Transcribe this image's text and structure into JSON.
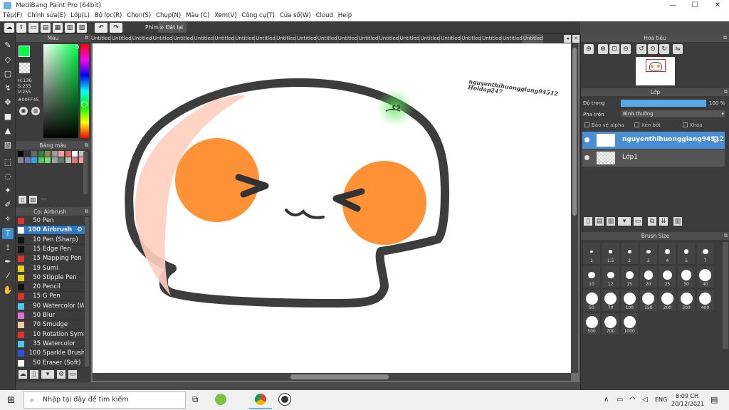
{
  "window": {
    "title": "MediBang Paint Pro (64bit)",
    "min": "—",
    "max": "☐",
    "close": "✕"
  },
  "menu": [
    "Tệp(F)",
    "Chỉnh sửa(E)",
    "Lớp(L)",
    "Bộ lọc(R)",
    "Chọn(S)",
    "Chụp(N)",
    "Màu (C)",
    "Xem(V)",
    "Công cụ(T)",
    "Cửa sổ(W)",
    "Cloud",
    "Help"
  ],
  "toolbar": {
    "phim_label": "Phím",
    "reset_label": "Đặt lại"
  },
  "tabs": {
    "label": "Untitled"
  },
  "color_panel": {
    "title": "Màu",
    "h": "H:136",
    "s": "S:255",
    "v": "V:255",
    "hex": "#00FF45",
    "fg_color": "#00ff45"
  },
  "swatch_panel": {
    "title": "Bảng màu",
    "value": "---"
  },
  "brush_panel": {
    "title": "Cọ: Airbrush",
    "brushes": [
      {
        "size": "50",
        "name": "Pen",
        "color": "#e03030"
      },
      {
        "size": "100",
        "name": "Airbrush",
        "color": "#ffffff"
      },
      {
        "size": "10",
        "name": "Pen (Sharp)",
        "color": "#111111"
      },
      {
        "size": "15",
        "name": "Edge Pen",
        "color": "#111111"
      },
      {
        "size": "15",
        "name": "Mapping Pen",
        "color": "#e03030"
      },
      {
        "size": "19",
        "name": "Sumi",
        "color": "#e8d020"
      },
      {
        "size": "50",
        "name": "Stipple Pen",
        "color": "#e8d020"
      },
      {
        "size": "20",
        "name": "Pencil",
        "color": "#111111"
      },
      {
        "size": "15",
        "name": "G Pen",
        "color": "#e03030"
      },
      {
        "size": "90",
        "name": "Watercolor (We",
        "color": "#4cc8e8"
      },
      {
        "size": "50",
        "name": "Blur",
        "color": "#e070e0"
      },
      {
        "size": "70",
        "name": "Smudge",
        "color": "#f0c8a0"
      },
      {
        "size": "10",
        "name": "Rotation Symm",
        "color": "#e03030"
      },
      {
        "size": "35",
        "name": "Watercolor",
        "color": "#4cc8e8"
      },
      {
        "size": "100",
        "name": "Sparkle Brush",
        "color": "#3050e0"
      },
      {
        "size": "50",
        "name": "Eraser (Soft)",
        "color": "#ffffff"
      }
    ]
  },
  "canvas": {
    "sig_line1": "nguyenthihuonggiang94512",
    "sig_line2": "Hoidap247"
  },
  "navigator": {
    "title": "Hoa tiêu"
  },
  "layer_panel": {
    "title": "Lớp",
    "opacity_label": "Độ trong",
    "opacity_value": "100 %",
    "opacity": 1.0,
    "blend_label": "Pha trộn",
    "blend_value": "Bình thường",
    "protect_alpha": "Bảo vệ alpha",
    "clipping": "Xén bớt",
    "lock": "Khóa",
    "layers": [
      "nguyenthihuonggiang94512",
      "Lớp1"
    ]
  },
  "brush_size_panel": {
    "title": "Brush Size",
    "sizes": [
      "1",
      "1.5",
      "2",
      "3",
      "4",
      "5",
      "7",
      "10",
      "12",
      "15",
      "20",
      "25",
      "30",
      "40",
      "50",
      "70",
      "100",
      "150",
      "200",
      "300",
      "400",
      "500",
      "700",
      "1000"
    ]
  },
  "taskbar": {
    "search_placeholder": "Nhập tại đây để tìm kiếm",
    "time": "8:09 CH",
    "date": "20/12/2021",
    "lang": "ENG"
  }
}
